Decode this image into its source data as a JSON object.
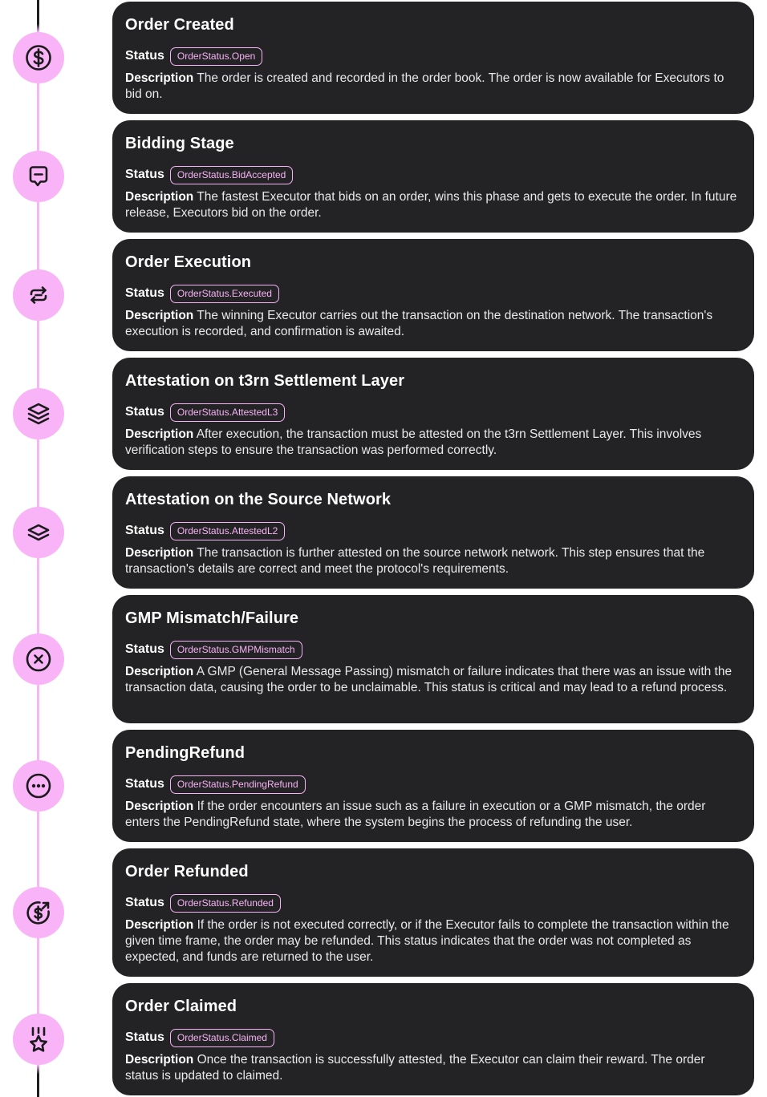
{
  "status_label": "Status",
  "description_label": "Description",
  "accent_color": "#f9b4f7",
  "card_color": "#232325",
  "stages": [
    {
      "icon": "dollar-circle-icon",
      "title": "Order Created",
      "status": "OrderStatus.Open",
      "description": "The order is created and recorded in the order book. The order is now available for Executors to bid on."
    },
    {
      "icon": "message-minus-icon",
      "title": "Bidding Stage",
      "status": "OrderStatus.BidAccepted",
      "description": "The fastest Executor that bids on an order, wins this phase and gets to execute the order. In future release, Executors bid on the order."
    },
    {
      "icon": "repeat-icon",
      "title": "Order Execution",
      "status": "OrderStatus.Executed",
      "description": "The winning Executor carries out the transaction on the destination network. The transaction's execution is recorded, and confirmation is awaited."
    },
    {
      "icon": "layers-three-icon",
      "title": "Attestation on t3rn Settlement Layer",
      "status": "OrderStatus.AttestedL3",
      "description": "After execution, the transaction must be attested on the t3rn Settlement Layer. This involves verification steps to ensure the transaction was performed correctly."
    },
    {
      "icon": "layers-two-icon",
      "title": "Attestation on the Source Network",
      "status": "OrderStatus.AttestedL2",
      "description": "The transaction is further attested on the source network network. This step ensures that the transaction's details are correct and meet the protocol's requirements."
    },
    {
      "icon": "x-circle-icon",
      "title": "GMP Mismatch/Failure",
      "status": "OrderStatus.GMPMismatch",
      "description": "A GMP (General Message Passing) mismatch or failure indicates that there was an issue with the transaction data, causing the order to be unclaimable. This status is critical and may lead to a refund process."
    },
    {
      "icon": "dots-circle-icon",
      "title": "PendingRefund",
      "status": "OrderStatus.PendingRefund",
      "description": "If the order encounters an issue such as a failure in execution or a GMP mismatch, the order enters the PendingRefund state, where the system begins the process of refunding the user."
    },
    {
      "icon": "coins-refund-icon",
      "title": "Order Refunded",
      "status": "OrderStatus.Refunded",
      "description": "If the order is not executed correctly, or if the Executor fails to complete the transaction within the given time frame, the order may be refunded. This status indicates that the order was not completed as expected, and funds are returned to the user."
    },
    {
      "icon": "award-star-icon",
      "title": "Order Claimed",
      "status": "OrderStatus.Claimed",
      "description": "Once the transaction is successfully attested, the Executor can claim their reward. The order status is updated to claimed."
    }
  ]
}
